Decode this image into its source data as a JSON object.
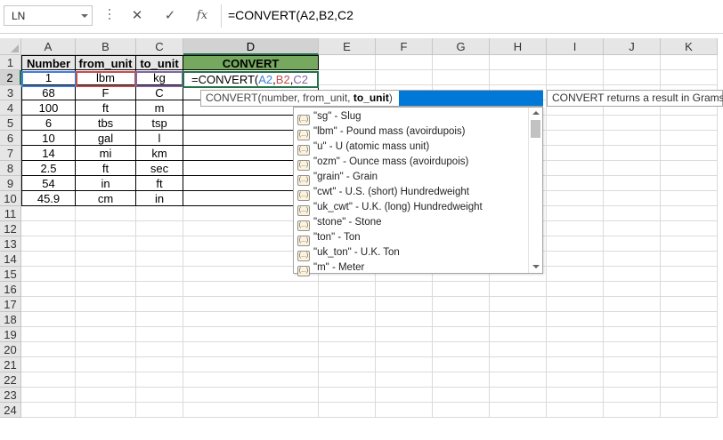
{
  "name_box": {
    "value": "LN"
  },
  "formula_bar": {
    "cancel_glyph": "✕",
    "enter_glyph": "✓",
    "fx_label": "fx",
    "formula": "=CONVERT(A2,B2,C2"
  },
  "columns": [
    "A",
    "B",
    "C",
    "D",
    "E",
    "F",
    "G",
    "H",
    "I",
    "J",
    "K"
  ],
  "rows": [
    "1",
    "2",
    "3",
    "4",
    "5",
    "6",
    "7",
    "8",
    "9",
    "10",
    "11",
    "12",
    "13",
    "14",
    "15",
    "16",
    "17",
    "18",
    "19",
    "20",
    "21",
    "22",
    "23",
    "24"
  ],
  "table": {
    "headers": [
      "Number",
      "from_unit",
      "to_unit",
      "CONVERT"
    ],
    "data": [
      [
        "1",
        "lbm",
        "kg"
      ],
      [
        "68",
        "F",
        "C"
      ],
      [
        "100",
        "ft",
        "m"
      ],
      [
        "6",
        "tbs",
        "tsp"
      ],
      [
        "10",
        "gal",
        "l"
      ],
      [
        "14",
        "mi",
        "km"
      ],
      [
        "2.5",
        "ft",
        "sec"
      ],
      [
        "54",
        "in",
        "ft"
      ],
      [
        "45.9",
        "cm",
        "in"
      ]
    ]
  },
  "active_cell": {
    "prefix": "=CONVERT(",
    "ref_a": "A2",
    "comma1": ",",
    "ref_b": "B2",
    "comma2": ",",
    "ref_c": "C2"
  },
  "argument_tooltip": {
    "prefix": "CONVERT(number, from_unit, ",
    "current": "to_unit",
    "suffix": ")"
  },
  "result_tooltip": "CONVERT returns a result in Grams",
  "autocomplete": {
    "icon_glyph": "(...)",
    "items": [
      "\"sg\" - Slug",
      "\"lbm\" - Pound mass (avoirdupois)",
      "\"u\" - U (atomic mass unit)",
      "\"ozm\" - Ounce mass (avoirdupois)",
      "\"grain\" - Grain",
      "\"cwt\" - U.S. (short) Hundredweight",
      "\"uk_cwt\" - U.K. (long) Hundredweight",
      "\"stone\" - Stone",
      "\"ton\" - Ton",
      "\"uk_ton\" - U.K. Ton",
      "\"m\" - Meter"
    ]
  },
  "colors": {
    "header_bg": "#e7e6e6",
    "convert_header_bg": "#76a860",
    "ref_a": "#3f7fdc",
    "ref_b": "#c0504d",
    "ref_c": "#8064a2",
    "selection": "#217346",
    "tooltip_highlight": "#0078d7"
  }
}
